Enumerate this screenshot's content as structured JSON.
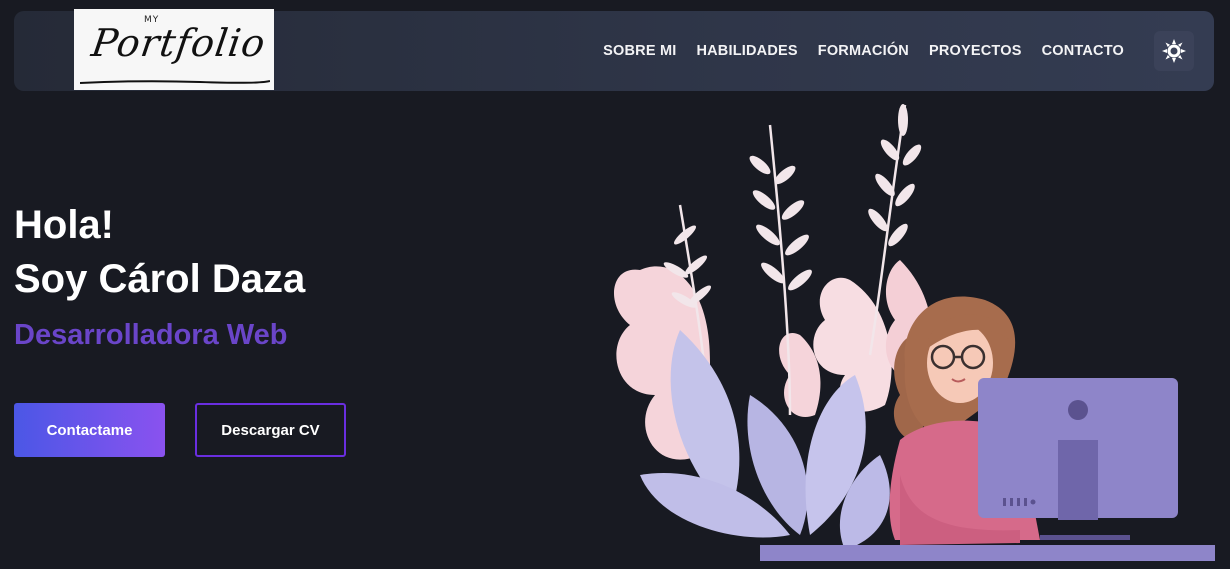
{
  "logo": {
    "my": "MY",
    "word": "Portfolio"
  },
  "nav": {
    "items": [
      {
        "label": "SOBRE MI"
      },
      {
        "label": "HABILIDADES"
      },
      {
        "label": "FORMACIÓN"
      },
      {
        "label": "PROYECTOS"
      },
      {
        "label": "CONTACTO"
      }
    ],
    "theme_icon": "sun-icon"
  },
  "hero": {
    "greeting": "Hola!",
    "name": "Soy Cárol Daza",
    "role": "Desarrolladora Web",
    "primary_button": "Contactame",
    "secondary_button": "Descargar CV"
  },
  "colors": {
    "background": "#181a22",
    "navbar": "#2f3649",
    "accent_purple": "#6a45c9",
    "button_gradient_start": "#4b57e6",
    "button_gradient_end": "#8a52ef",
    "outline_button": "#6a2ee0"
  },
  "illustration": "woman-at-computer-with-plants"
}
